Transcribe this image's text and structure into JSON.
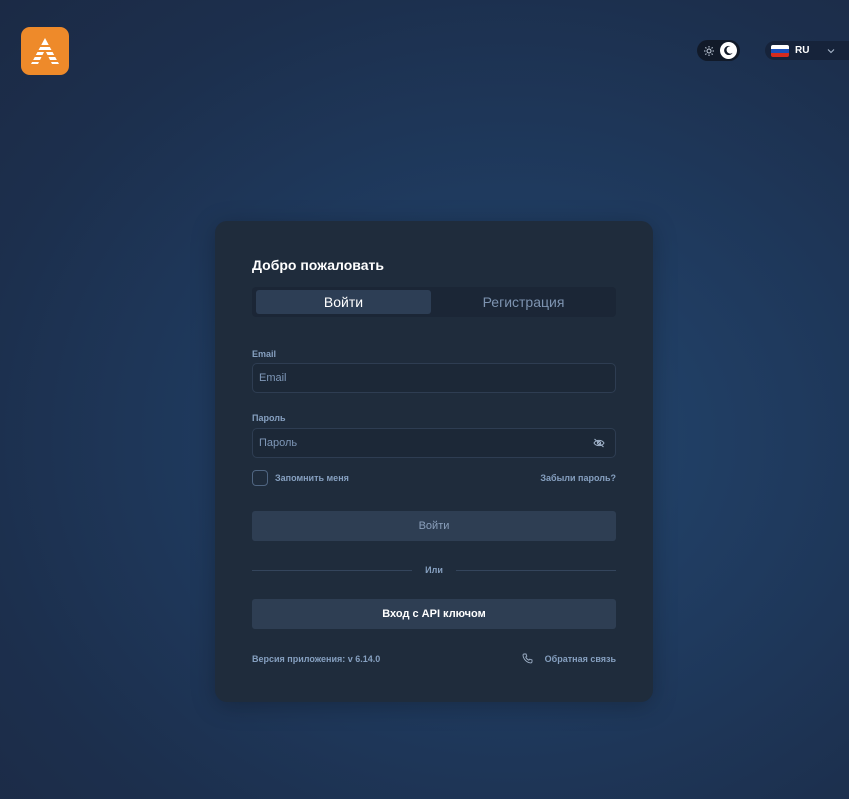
{
  "colors": {
    "brand": "#ee8a2a",
    "card": "#1f2c3c",
    "button": "#2e3e53",
    "muted_text": "#86a0c0"
  },
  "header": {
    "logo_icon": "logo-a-icon",
    "theme_toggle": {
      "light_icon": "sun-icon",
      "dark_icon": "moon-icon",
      "mode": "dark"
    },
    "language": {
      "code": "RU",
      "flag_icon": "russia-flag-icon",
      "chevron_icon": "chevron-down-icon"
    }
  },
  "card": {
    "title": "Добро пожаловать",
    "tabs": [
      {
        "label": "Войти",
        "active": true
      },
      {
        "label": "Регистрация",
        "active": false
      }
    ],
    "email": {
      "label": "Email",
      "placeholder": "Email",
      "value": ""
    },
    "password": {
      "label": "Пароль",
      "placeholder": "Пароль",
      "value": "",
      "toggle_icon": "eye-off-icon"
    },
    "remember_label": "Запомнить меня",
    "forgot_label": "Забыли пароль?",
    "login_button": "Войти",
    "divider_text": "Или",
    "api_button": "Вход с API ключом",
    "version": "Версия приложения: v 6.14.0",
    "feedback": {
      "label": "Обратная связь",
      "icon": "phone-icon"
    }
  }
}
